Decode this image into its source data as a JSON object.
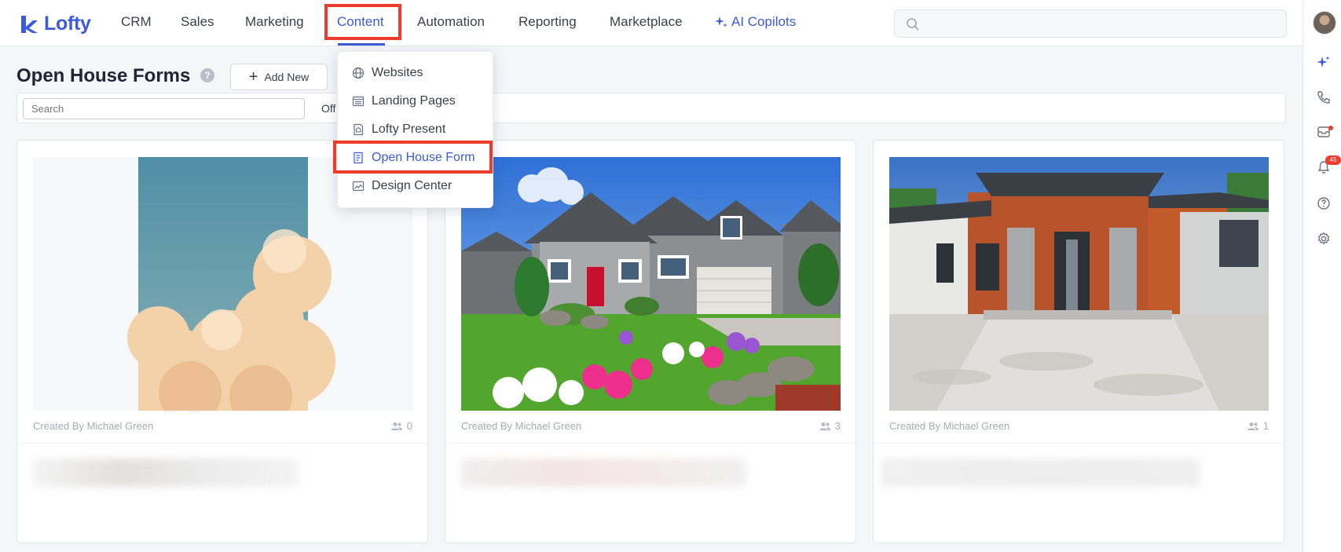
{
  "nav": {
    "logo": "Lofty",
    "items": [
      "CRM",
      "Sales",
      "Marketing",
      "Content",
      "Automation",
      "Reporting",
      "Marketplace"
    ],
    "ai_label": "AI Copilots",
    "accent_color": "#3b5bdb",
    "highlight_color": "#ef3b2d"
  },
  "rail": {
    "icons": [
      "avatar",
      "sparkle-icon",
      "phone-icon",
      "inbox-icon",
      "bell-icon",
      "help-icon",
      "gear-icon"
    ],
    "notification_count": "45"
  },
  "page": {
    "title": "Open House Forms",
    "add_button": "Add New",
    "search_placeholder": "Search",
    "filter_label": "Off"
  },
  "dropdown": {
    "items": [
      "Websites",
      "Landing Pages",
      "Lofty Present",
      "Open House Form",
      "Design Center"
    ],
    "active": "Open House Form"
  },
  "cards": [
    {
      "created_by": "Created By Michael Green",
      "count": "0",
      "image": "sky-clouds"
    },
    {
      "created_by": "Created By Michael Green",
      "count": "3",
      "image": "suburban-house-garden"
    },
    {
      "created_by": "Created By Michael Green",
      "count": "1",
      "image": "modern-house"
    }
  ]
}
